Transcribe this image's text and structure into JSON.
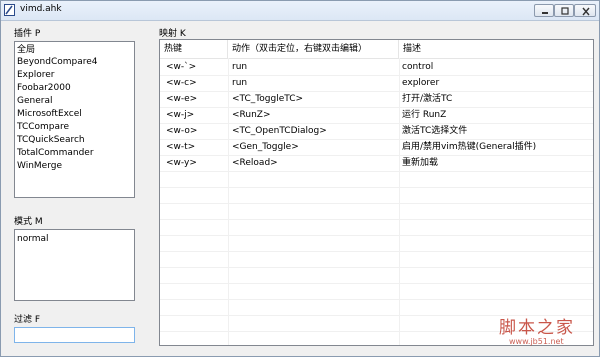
{
  "window": {
    "title": "vimd.ahk"
  },
  "plugins": {
    "label": "插件 P",
    "items": [
      "全局",
      "BeyondCompare4",
      "Explorer",
      "Foobar2000",
      "General",
      "MicrosoftExcel",
      "TCCompare",
      "TCQuickSearch",
      "TotalCommander",
      "WinMerge"
    ]
  },
  "mode": {
    "label": "模式 M",
    "items": [
      "normal"
    ]
  },
  "filter": {
    "label": "过滤 F",
    "value": ""
  },
  "mapping": {
    "label": "映射 K",
    "columns": [
      "热键",
      "动作（双击定位，右键双击编辑）",
      "描述"
    ],
    "rows": [
      [
        "<w-`>",
        "run",
        "control"
      ],
      [
        "<w-c>",
        "run",
        "explorer"
      ],
      [
        "<w-e>",
        "<TC_ToggleTC>",
        "打开/激活TC"
      ],
      [
        "<w-j>",
        "<RunZ>",
        "运行 RunZ"
      ],
      [
        "<w-o>",
        "<TC_OpenTCDialog>",
        "激活TC选择文件"
      ],
      [
        "<w-t>",
        "<Gen_Toggle>",
        "启用/禁用vim热键(General插件)"
      ],
      [
        "<w-y>",
        "<Reload>",
        "重新加载"
      ]
    ]
  },
  "watermark": {
    "text": "脚本之家",
    "url": "www.jb51.net"
  }
}
